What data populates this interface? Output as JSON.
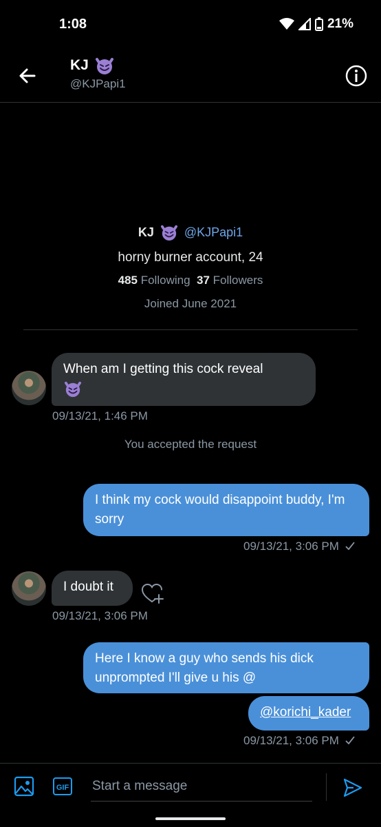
{
  "status": {
    "time": "1:08",
    "battery": "21%"
  },
  "header": {
    "name": "KJ",
    "handle": "@KJPapi1"
  },
  "profile": {
    "name": "KJ",
    "handle": "@KJPapi1",
    "bio": "horny burner account, 24",
    "following_count": "485",
    "following_label": "Following",
    "followers_count": "37",
    "followers_label": "Followers",
    "joined": "Joined June 2021"
  },
  "messages": {
    "m1": {
      "text": "When am I getting this cock reveal",
      "time": "09/13/21, 1:46 PM"
    },
    "system": "You accepted the request",
    "m2": {
      "text": "I think my cock would disappoint buddy, I'm sorry",
      "time": "09/13/21, 3:06 PM"
    },
    "m3": {
      "text": "I doubt it",
      "time": "09/13/21, 3:06 PM"
    },
    "m4": {
      "text": "Here I know a guy who sends his dick unprompted I'll give u his @",
      "link": "@korichi_kader",
      "time": "09/13/21, 3:06 PM"
    }
  },
  "composer": {
    "placeholder": "Start a message",
    "gif_label": "GIF"
  },
  "colors": {
    "accent": "#1d9bf0",
    "outgoing_bubble": "#4a90d9",
    "incoming_bubble": "#2f3336"
  },
  "icons": [
    "back-arrow-icon",
    "info-icon",
    "smiling-devil-emoji",
    "heart-add-icon",
    "image-icon",
    "gif-icon",
    "send-icon",
    "wifi-icon",
    "signal-icon",
    "battery-icon",
    "check-icon"
  ]
}
